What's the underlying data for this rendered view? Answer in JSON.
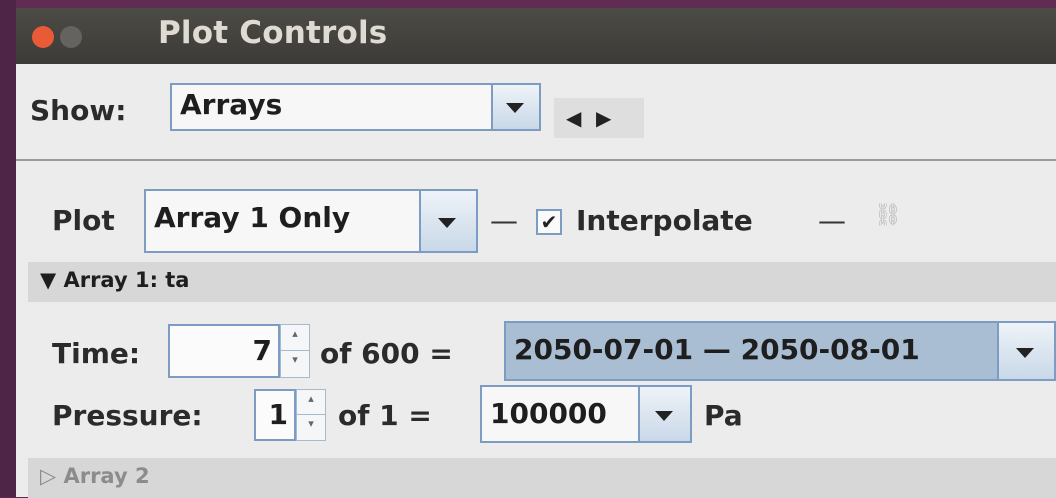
{
  "window": {
    "title": "Plot Controls"
  },
  "show": {
    "label": "Show:",
    "value": "Arrays"
  },
  "plot": {
    "label": "Plot",
    "mode": "Array 1 Only",
    "dash1": "—",
    "dash2": "—",
    "interpolate_label": "Interpolate",
    "interpolate_checked": true,
    "check_glyph": "✔",
    "link_icon": "link-icon"
  },
  "array1": {
    "header": "▼ Array 1: ta",
    "time": {
      "label": "Time:",
      "index": "7",
      "of_text": "of 600 =",
      "range": "2050-07-01 — 2050-08-01"
    },
    "pressure": {
      "label": "Pressure:",
      "index": "1",
      "of_text": "of 1 =",
      "value": "100000",
      "unit": "Pa"
    }
  },
  "array2": {
    "header": "▷ Array 2"
  },
  "colors": {
    "accent_border": "#7c9cc4",
    "close_button": "#e95a37",
    "titlebar": "#3c3b37"
  }
}
